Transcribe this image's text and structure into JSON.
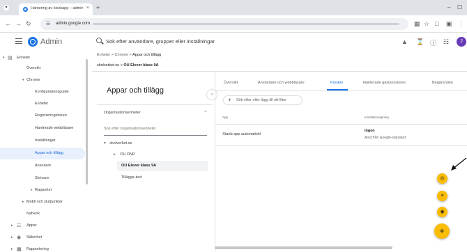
{
  "browser": {
    "tab_menu_glyph": "▾",
    "tab_title": "Hantering av kioskapp – admin",
    "tab_close": "×",
    "new_tab": "+",
    "minimize": "–",
    "maximize": "☐",
    "url_host": "admin.google.com",
    "back": "←",
    "forward": "→",
    "reload": "↻"
  },
  "header": {
    "app_name": "Admin",
    "search_placeholder": "Sök efter användare, grupper eller inställningar",
    "avatar_initial": "J"
  },
  "sidebar": {
    "items": [
      {
        "label": "Enheter"
      },
      {
        "label": "Översikt"
      },
      {
        "label": "Chrome"
      },
      {
        "label": "Konfigurationsguide"
      },
      {
        "label": "Enheter"
      },
      {
        "label": "Registreringstoken"
      },
      {
        "label": "Hanterade webbläsare"
      },
      {
        "label": "Inställningar"
      },
      {
        "label": "Appar och tillägg"
      },
      {
        "label": "Anslutare"
      },
      {
        "label": "Skrivare"
      },
      {
        "label": "Rapporter"
      },
      {
        "label": "Mobil och slutpunkter"
      },
      {
        "label": "Nätverk"
      },
      {
        "label": "Appar"
      },
      {
        "label": "Säkerhet"
      },
      {
        "label": "Rapportering"
      }
    ]
  },
  "breadcrumb": {
    "part1": "Enheter",
    "sep": ">",
    "part2": "Chrome",
    "part3": "Appar och tillägg"
  },
  "org_path": {
    "root": "skolverket.se",
    "sep": ">",
    "current": "OU Elever klass 9A"
  },
  "left_panel": {
    "title": "Appar och tillägg",
    "org_units_label": "Organisationsenheter",
    "search_placeholder": "Sök efter organisationsenheter",
    "tree": [
      {
        "label": "skolverket.se"
      },
      {
        "label": "OU DNP"
      },
      {
        "label": "OU Elever klass 9A"
      },
      {
        "label": "Tilläggs-test"
      }
    ]
  },
  "tabs": [
    {
      "label": "Översikt"
    },
    {
      "label": "Användare och webbläsare"
    },
    {
      "label": "Kiosker"
    },
    {
      "label": "Hanterade gästsessioner"
    },
    {
      "label": "Begäranden"
    }
  ],
  "table": {
    "filter_placeholder": "Sök efter eller lägg till ett filter",
    "col_app": "App",
    "col_policy": "Installationspolicy",
    "rows": [
      {
        "app": "Starta app automatiskt",
        "policy": "Ingen",
        "inherited": "Arvd från Google-standard"
      }
    ]
  },
  "fabs": {
    "web_glyph": "◎",
    "list_glyph": "≡",
    "android_glyph": "◉",
    "add_glyph": "+"
  }
}
